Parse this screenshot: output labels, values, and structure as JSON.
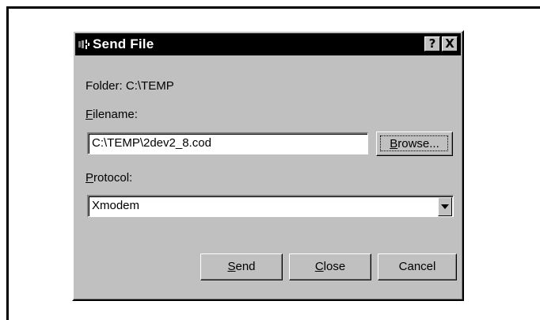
{
  "dialog": {
    "title": "Send File",
    "help_label": "?",
    "close_label": "X"
  },
  "folder": {
    "label": "Folder:",
    "path": "C:\\TEMP"
  },
  "filename": {
    "label_mnemonic": "F",
    "label_rest": "ilename:",
    "value": "C:\\TEMP\\2dev2_8.cod",
    "browse_mnemonic": "B",
    "browse_rest": "rowse..."
  },
  "protocol": {
    "label_mnemonic": "P",
    "label_rest": "rotocol:",
    "selected": "Xmodem"
  },
  "buttons": {
    "send_mnemonic": "S",
    "send_rest": "end",
    "close_mnemonic": "C",
    "close_rest": "lose",
    "cancel": "Cancel"
  },
  "icons": {
    "title": "modem-icon",
    "dropdown": "chevron-down-icon"
  }
}
